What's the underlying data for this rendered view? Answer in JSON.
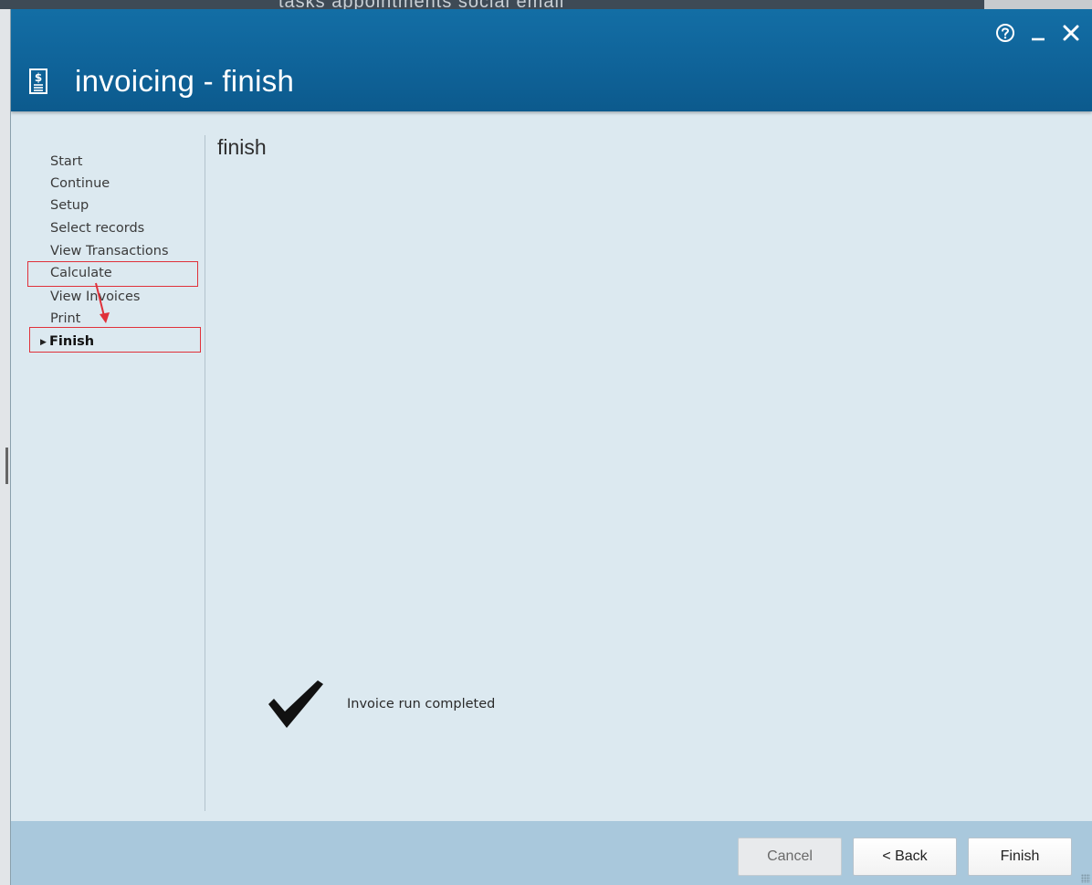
{
  "background": {
    "partial_text": "tasks   appointments   social   email"
  },
  "dialog": {
    "title": "invoicing - finish",
    "icons": {
      "title": "invoice-document-icon",
      "help": "help-circle-icon",
      "minimize": "minimize-icon",
      "close": "close-icon"
    }
  },
  "steps": [
    {
      "label": "Start"
    },
    {
      "label": "Continue"
    },
    {
      "label": "Setup"
    },
    {
      "label": "Select records"
    },
    {
      "label": "View Transactions"
    },
    {
      "label": "Calculate"
    },
    {
      "label": "View Invoices"
    },
    {
      "label": "Print"
    },
    {
      "label": "Finish",
      "current": true
    }
  ],
  "content": {
    "section_title": "finish",
    "status_icon": "checkmark-icon",
    "status_text": "Invoice run completed"
  },
  "footer": {
    "cancel_label": "Cancel",
    "back_label": "< Back",
    "finish_label": "Finish"
  },
  "colors": {
    "titlebar": "#0f6399",
    "content_bg": "#dce9f0",
    "footer_bg": "#a9c8dc",
    "annotation_red": "#e0313a"
  }
}
